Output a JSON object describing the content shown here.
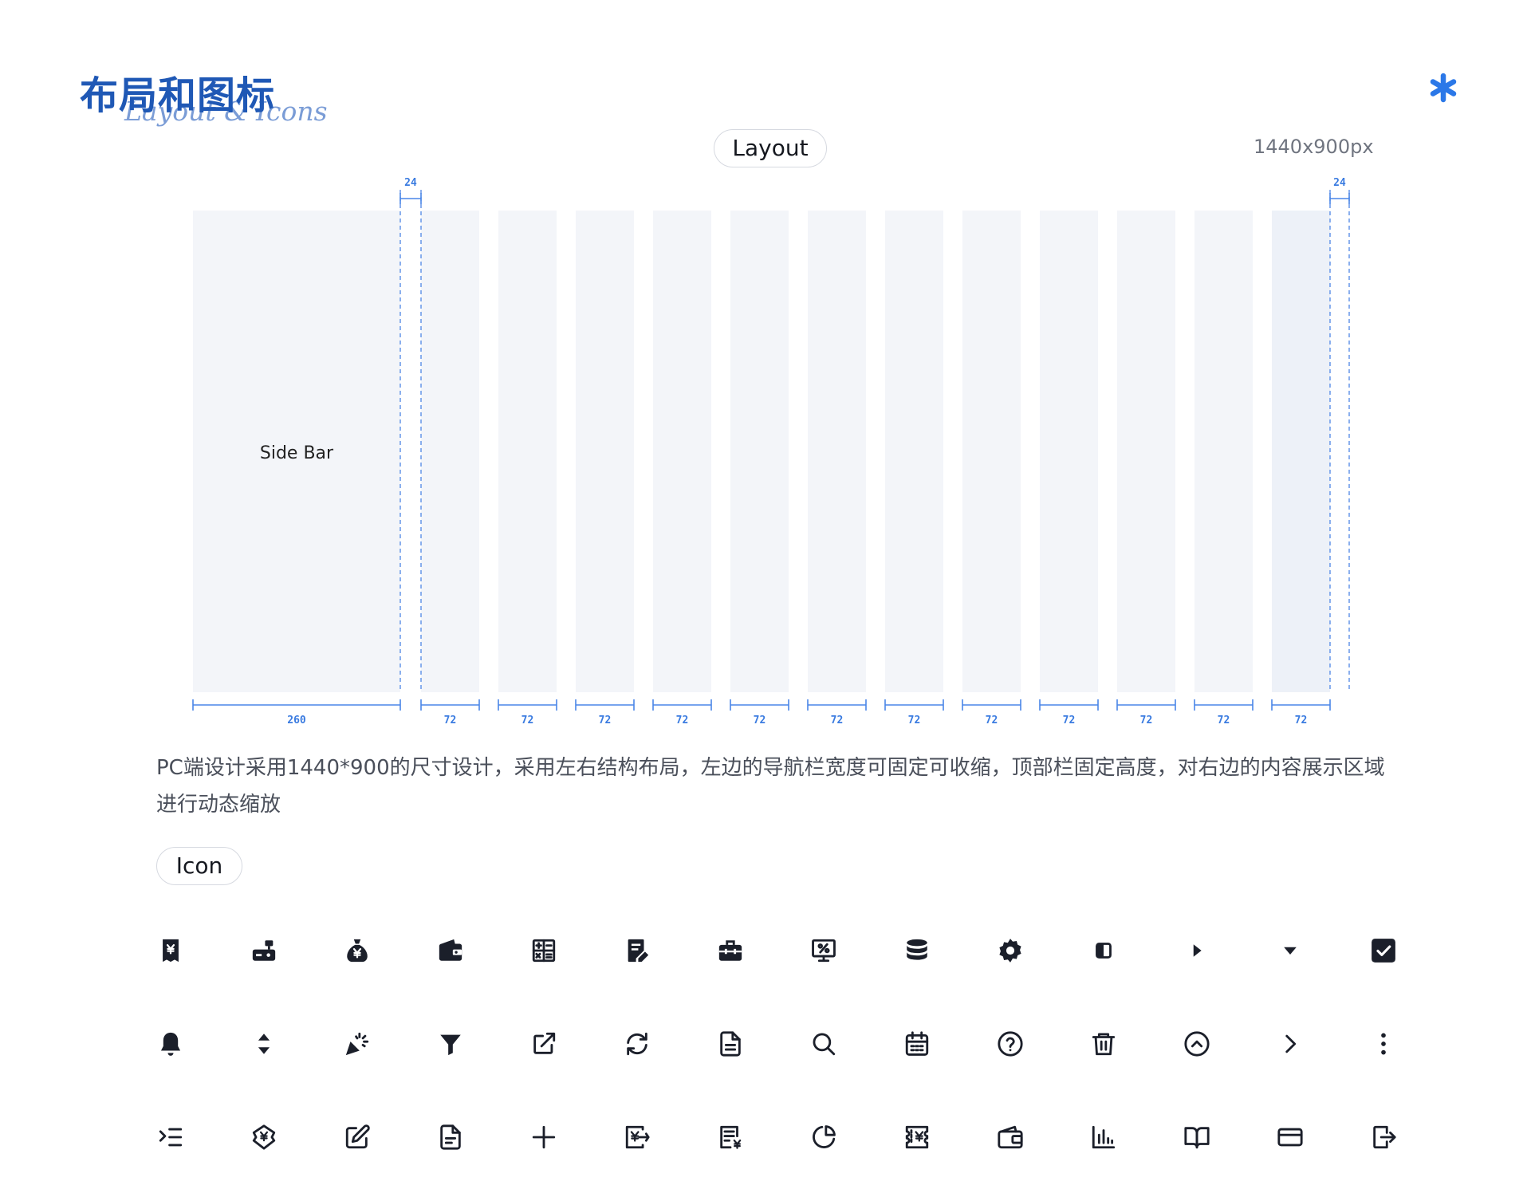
{
  "header": {
    "title_cn": "布局和图标",
    "title_en": "Layout & Icons",
    "asterisk_icon": "asterisk-icon",
    "accent_color": "#2b78e8"
  },
  "layout_section": {
    "pill_label": "Layout",
    "size_label": "1440x900px",
    "sidebar_label": "Side Bar",
    "sidebar_width": "260",
    "margin_width": "24",
    "column_width": "72",
    "column_count": 12,
    "description": "PC端设计采用1440*900的尺寸设计，采用左右结构布局，左边的导航栏宽度可固定可收缩，顶部栏固定高度，对右边的内容展示区域进行动态缩放"
  },
  "icon_section": {
    "pill_label": "Icon",
    "rows": [
      [
        "receipt-icon",
        "cash-register-icon",
        "money-bag-icon",
        "wallet-icon",
        "calculator-icon",
        "edit-document-icon",
        "briefcase-icon",
        "monitor-percent-icon",
        "database-icon",
        "gear-icon",
        "half-square-icon",
        "triangle-right-icon",
        "triangle-down-icon",
        "checkbox-checked-icon"
      ],
      [
        "bell-icon",
        "sort-icon",
        "party-popper-icon",
        "filter-icon",
        "external-link-icon",
        "refresh-icon",
        "file-text-icon",
        "search-icon",
        "calendar-icon",
        "help-circle-icon",
        "trash-icon",
        "chevron-up-circle-icon",
        "chevron-right-icon",
        "more-vertical-icon"
      ],
      [
        "indent-icon",
        "yen-tag-icon",
        "edit-icon",
        "file-icon",
        "plus-icon",
        "yen-transfer-icon",
        "invoice-yen-icon",
        "pie-chart-icon",
        "yen-ticket-icon",
        "wallet-outline-icon",
        "bar-chart-icon",
        "book-open-icon",
        "credit-card-icon",
        "logout-icon"
      ]
    ]
  }
}
